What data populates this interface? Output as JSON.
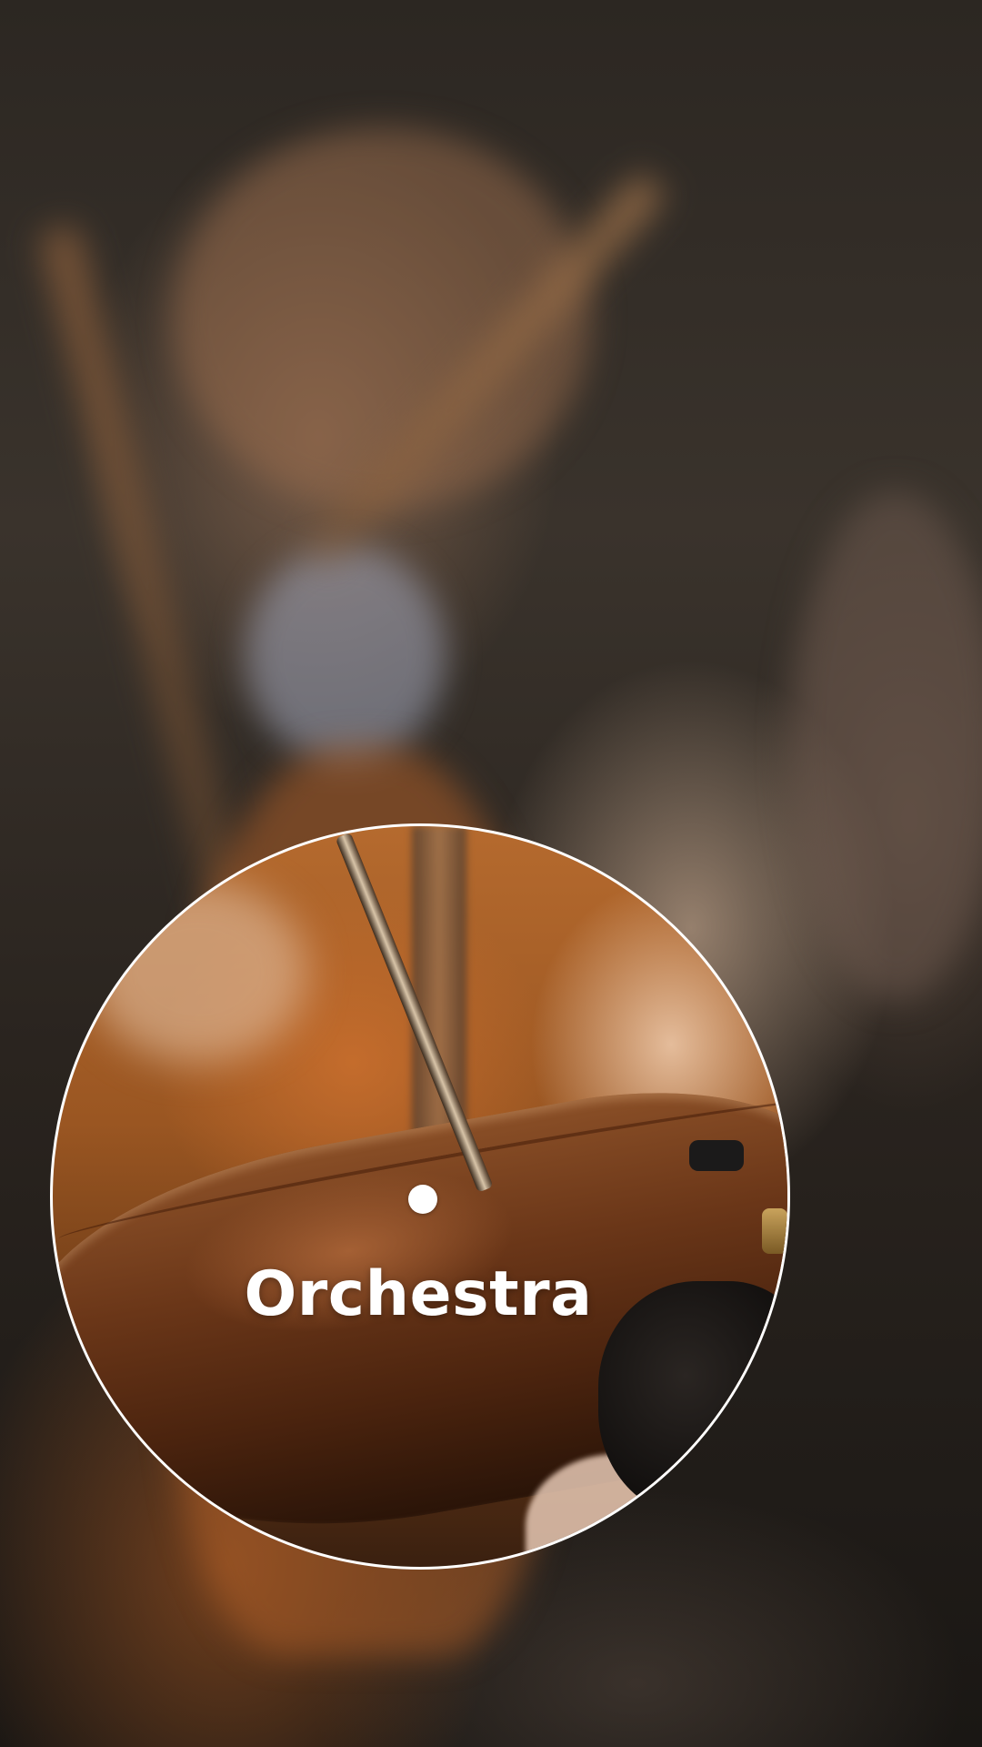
{
  "screen": {
    "title": "Orchestra"
  },
  "icons": {
    "marker": "focus-point-dot"
  },
  "colors": {
    "text": "#ffffff",
    "lens_border": "#ffffff",
    "marker": "#ffffff"
  }
}
